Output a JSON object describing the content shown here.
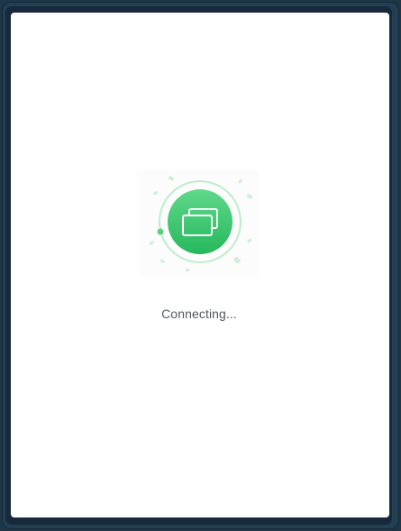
{
  "window": {
    "theme_color": "#1e3648",
    "panel_color": "#ffffff"
  },
  "loader": {
    "icon": "screen-share-icon",
    "accent_color": "#2fbd66",
    "ring_color": "#b7ebc9"
  },
  "status": {
    "text": "Connecting..."
  }
}
